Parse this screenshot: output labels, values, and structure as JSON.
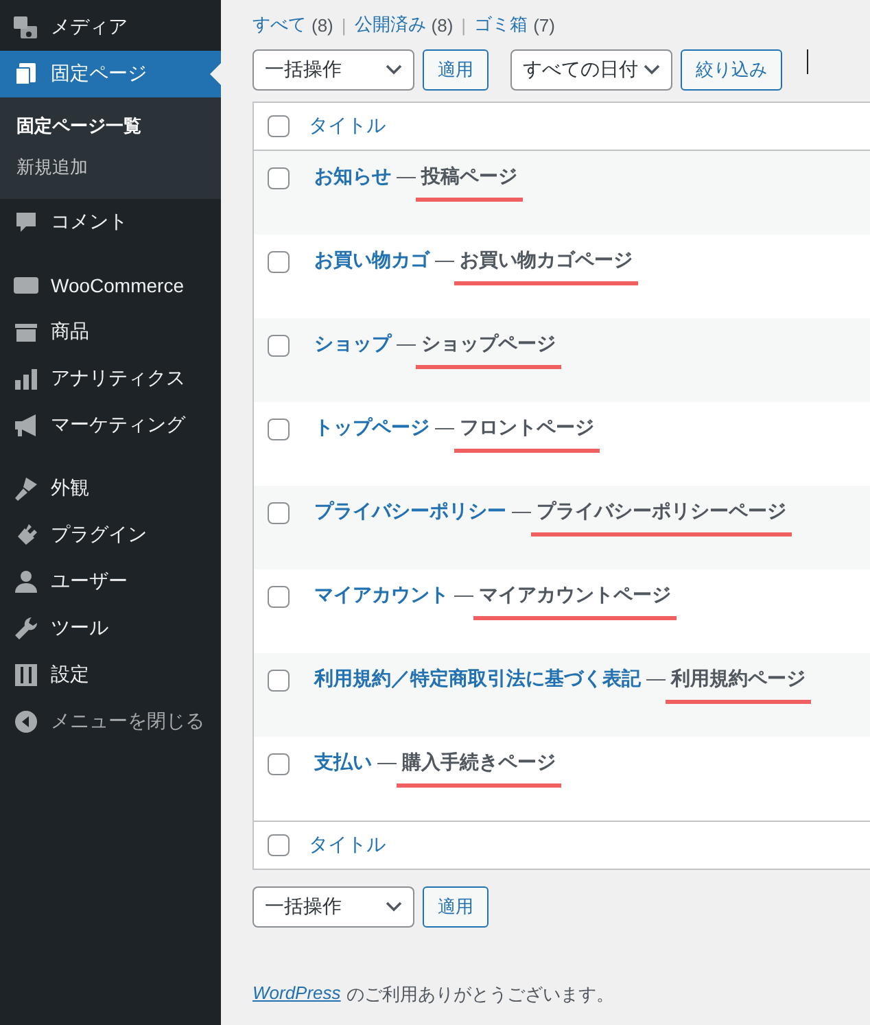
{
  "sidebar": {
    "items": [
      {
        "label": "メディア",
        "selected": false
      },
      {
        "label": "固定ページ",
        "selected": true,
        "children": [
          {
            "label": "固定ページ一覧",
            "selected": true
          },
          {
            "label": "新規追加",
            "selected": false
          }
        ]
      },
      {
        "label": "コメント",
        "selected": false
      },
      {
        "label": "WooCommerce",
        "selected": false,
        "gap_before": true
      },
      {
        "label": "商品",
        "selected": false
      },
      {
        "label": "アナリティクス",
        "selected": false
      },
      {
        "label": "マーケティング",
        "selected": false
      },
      {
        "label": "外観",
        "selected": false,
        "gap_before": true
      },
      {
        "label": "プラグイン",
        "selected": false
      },
      {
        "label": "ユーザー",
        "selected": false
      },
      {
        "label": "ツール",
        "selected": false
      },
      {
        "label": "設定",
        "selected": false
      },
      {
        "label": "メニューを閉じる",
        "selected": false,
        "kind": "collapse"
      }
    ]
  },
  "filters": [
    {
      "label": "すべて",
      "count": "(8)"
    },
    {
      "separator": "|",
      "label": "公開済み",
      "count": "(8)"
    },
    {
      "separator": "|",
      "label": "ゴミ箱",
      "count": "(7)"
    }
  ],
  "toolbar": {
    "bulk_action": "一括操作",
    "apply": "適用",
    "date_filter": "すべての日付",
    "filter": "絞り込み"
  },
  "table": {
    "column_header": "タイトル",
    "header_checked": false,
    "footer_checked": false,
    "rows": [
      {
        "title": "お知らせ",
        "dash": "—",
        "state": "投稿ページ",
        "checked": false,
        "marked": true
      },
      {
        "title": "お買い物カゴ",
        "dash": "—",
        "state": "お買い物カゴページ",
        "checked": false,
        "marked": true
      },
      {
        "title": "ショップ",
        "dash": "—",
        "state": "ショップページ",
        "checked": false,
        "marked": true
      },
      {
        "title": "トップページ",
        "dash": "—",
        "state": "フロントページ",
        "checked": false,
        "marked": true
      },
      {
        "title": "プライバシーポリシー",
        "dash": "—",
        "state": "プライバシーポリシーページ",
        "checked": false,
        "marked": true
      },
      {
        "title": "マイアカウント",
        "dash": "—",
        "state": "マイアカウントページ",
        "checked": false,
        "marked": true
      },
      {
        "title": "利用規約／特定商取引法に基づく表記",
        "dash": "—",
        "state": "利用規約ページ",
        "checked": false,
        "marked": true
      },
      {
        "title": "支払い",
        "dash": "—",
        "state": "購入手続きページ",
        "checked": false,
        "marked": true
      }
    ],
    "column_footer": "タイトル"
  },
  "bottom_toolbar": {
    "bulk_action": "一括操作",
    "apply": "適用"
  },
  "footer": {
    "link": "WordPress",
    "text": "のご利用ありがとうございます。"
  }
}
